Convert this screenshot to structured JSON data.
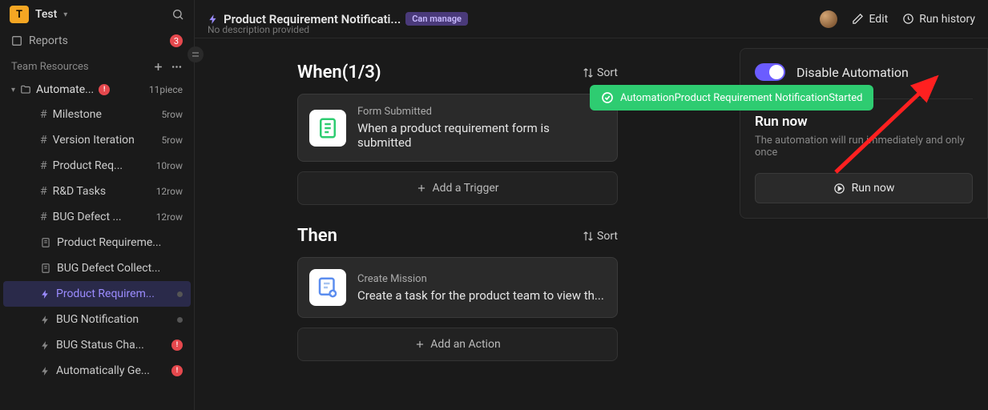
{
  "workspace": {
    "badge": "T",
    "name": "Test"
  },
  "nav": {
    "reports": {
      "label": "Reports",
      "badge": "3"
    },
    "section_label": "Team Resources",
    "folder": {
      "label": "Automate...",
      "meta": "11piece",
      "alert": "!"
    },
    "items": [
      {
        "icon": "hash",
        "label": "Milestone",
        "meta": "5row"
      },
      {
        "icon": "hash",
        "label": "Version Iteration",
        "meta": "5row"
      },
      {
        "icon": "hash",
        "label": "Product Req...",
        "meta": "10row"
      },
      {
        "icon": "hash",
        "label": "R&D Tasks",
        "meta": "12row"
      },
      {
        "icon": "hash",
        "label": "BUG Defect ...",
        "meta": "12row"
      },
      {
        "icon": "doc",
        "label": "Product Requireme..."
      },
      {
        "icon": "doc",
        "label": "BUG Defect Collect..."
      },
      {
        "icon": "bolt",
        "label": "Product Requirem...",
        "active": true,
        "dot": true
      },
      {
        "icon": "bolt",
        "label": "BUG Notification",
        "dot": true
      },
      {
        "icon": "bolt",
        "label": "BUG Status Cha...",
        "alert": "!"
      },
      {
        "icon": "bolt",
        "label": "Automatically Ge...",
        "alert": "!"
      }
    ]
  },
  "header": {
    "title": "Product Requirement Notificati...",
    "badge": "Can manage",
    "subtitle": "No description provided",
    "edit": "Edit",
    "run_history": "Run history"
  },
  "when": {
    "title": "When(1/3)",
    "sort": "Sort",
    "card_title": "Form Submitted",
    "card_desc": "When a product requirement form is submitted",
    "add": "Add a Trigger"
  },
  "then": {
    "title": "Then",
    "sort": "Sort",
    "card_title": "Create Mission",
    "card_desc": "Create a task for the product team to view th...",
    "add": "Add an Action"
  },
  "panel": {
    "toggle_label": "Disable Automation",
    "run_title": "Run now",
    "run_sub": "The automation will run immediately and only once",
    "run_btn": "Run now"
  },
  "toast": {
    "text": "AutomationProduct Requirement NotificationStarted"
  }
}
